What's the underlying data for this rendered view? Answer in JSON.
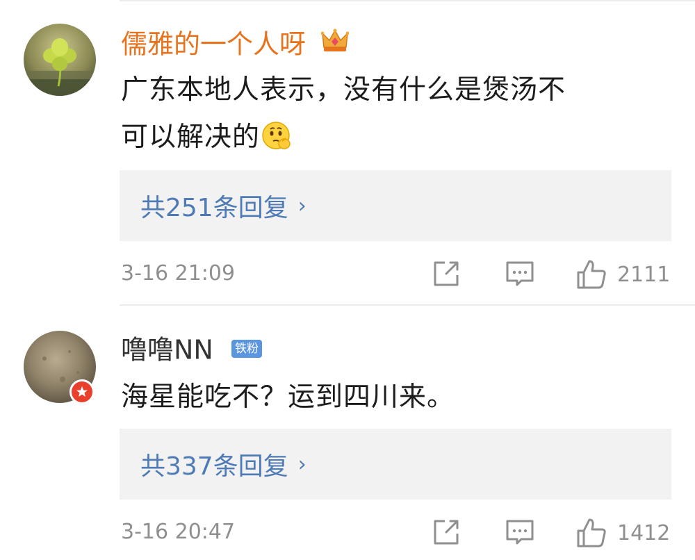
{
  "comments": [
    {
      "username": "儒雅的一个人呀",
      "username_color": "#e8731e",
      "badge_icon": "crown-icon",
      "text_line1": "广东本地人表示，没有什么是煲汤不",
      "text_line2": "可以解决的",
      "inline_emoji": "thinking-face-icon",
      "replies_label": "共251条回复",
      "timestamp": "3-16 21:09",
      "like_count": "2111"
    },
    {
      "username": "噜噜NN",
      "username_color": "#333333",
      "fan_badge": "铁粉",
      "text_line1": "海星能吃不？运到四川来。",
      "replies_label": "共337条回复",
      "timestamp": "3-16 20:47",
      "like_count": "1412"
    }
  ],
  "colors": {
    "reply_link": "#4e7bb5",
    "meta_gray": "#8f8f8f",
    "reply_bg": "#f2f2f2",
    "fan_badge_bg": "#5b95e0"
  }
}
